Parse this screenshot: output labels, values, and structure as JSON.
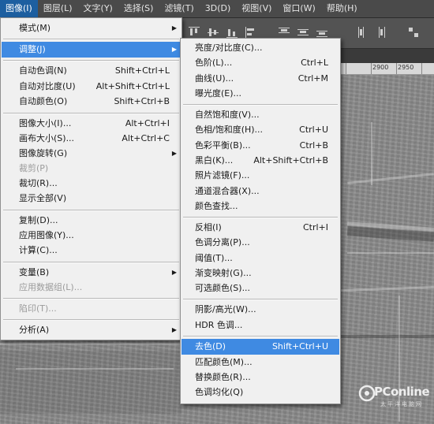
{
  "menubar": {
    "items": [
      {
        "label": "图像(I)",
        "active": true
      },
      {
        "label": "图层(L)"
      },
      {
        "label": "文字(Y)"
      },
      {
        "label": "选择(S)"
      },
      {
        "label": "滤镜(T)"
      },
      {
        "label": "3D(D)"
      },
      {
        "label": "视图(V)"
      },
      {
        "label": "窗口(W)"
      },
      {
        "label": "帮助(H)"
      }
    ]
  },
  "ruler": {
    "labels": [
      "2900",
      "2950"
    ]
  },
  "image_menu": {
    "items": [
      {
        "label": "模式(M)",
        "shortcut": "",
        "submenu": true
      },
      {
        "label": "调整(J)",
        "shortcut": "",
        "submenu": true,
        "highlighted": true
      },
      {
        "label": "自动色调(N)",
        "shortcut": "Shift+Ctrl+L"
      },
      {
        "label": "自动对比度(U)",
        "shortcut": "Alt+Shift+Ctrl+L"
      },
      {
        "label": "自动颜色(O)",
        "shortcut": "Shift+Ctrl+B"
      },
      {
        "label": "图像大小(I)...",
        "shortcut": "Alt+Ctrl+I"
      },
      {
        "label": "画布大小(S)...",
        "shortcut": "Alt+Ctrl+C"
      },
      {
        "label": "图像旋转(G)",
        "shortcut": "",
        "submenu": true
      },
      {
        "label": "裁剪(P)",
        "shortcut": "",
        "disabled": true
      },
      {
        "label": "裁切(R)...",
        "shortcut": ""
      },
      {
        "label": "显示全部(V)",
        "shortcut": ""
      },
      {
        "label": "复制(D)...",
        "shortcut": ""
      },
      {
        "label": "应用图像(Y)...",
        "shortcut": ""
      },
      {
        "label": "计算(C)...",
        "shortcut": ""
      },
      {
        "label": "变量(B)",
        "shortcut": "",
        "submenu": true
      },
      {
        "label": "应用数据组(L)...",
        "shortcut": "",
        "disabled": true
      },
      {
        "label": "陷印(T)...",
        "shortcut": "",
        "disabled": true
      },
      {
        "label": "分析(A)",
        "shortcut": "",
        "submenu": true
      }
    ]
  },
  "adjust_menu": {
    "items": [
      {
        "label": "亮度/对比度(C)...",
        "shortcut": ""
      },
      {
        "label": "色阶(L)...",
        "shortcut": "Ctrl+L"
      },
      {
        "label": "曲线(U)...",
        "shortcut": "Ctrl+M"
      },
      {
        "label": "曝光度(E)...",
        "shortcut": ""
      },
      {
        "label": "自然饱和度(V)...",
        "shortcut": ""
      },
      {
        "label": "色相/饱和度(H)...",
        "shortcut": "Ctrl+U"
      },
      {
        "label": "色彩平衡(B)...",
        "shortcut": "Ctrl+B"
      },
      {
        "label": "黑白(K)...",
        "shortcut": "Alt+Shift+Ctrl+B"
      },
      {
        "label": "照片滤镜(F)...",
        "shortcut": ""
      },
      {
        "label": "通道混合器(X)...",
        "shortcut": ""
      },
      {
        "label": "颜色查找...",
        "shortcut": ""
      },
      {
        "label": "反相(I)",
        "shortcut": "Ctrl+I"
      },
      {
        "label": "色调分离(P)...",
        "shortcut": ""
      },
      {
        "label": "阈值(T)...",
        "shortcut": ""
      },
      {
        "label": "渐变映射(G)...",
        "shortcut": ""
      },
      {
        "label": "可选颜色(S)...",
        "shortcut": ""
      },
      {
        "label": "阴影/高光(W)...",
        "shortcut": ""
      },
      {
        "label": "HDR 色调...",
        "shortcut": ""
      },
      {
        "label": "去色(D)",
        "shortcut": "Shift+Ctrl+U",
        "highlighted": true
      },
      {
        "label": "匹配颜色(M)...",
        "shortcut": ""
      },
      {
        "label": "替换颜色(R)...",
        "shortcut": ""
      },
      {
        "label": "色调均化(Q)",
        "shortcut": ""
      }
    ]
  },
  "watermark": {
    "brand": "PConline",
    "sub": "太平洋电脑网"
  },
  "colors": {
    "highlight": "#3f8ae2",
    "menubar_active": "#1d5fa0"
  }
}
